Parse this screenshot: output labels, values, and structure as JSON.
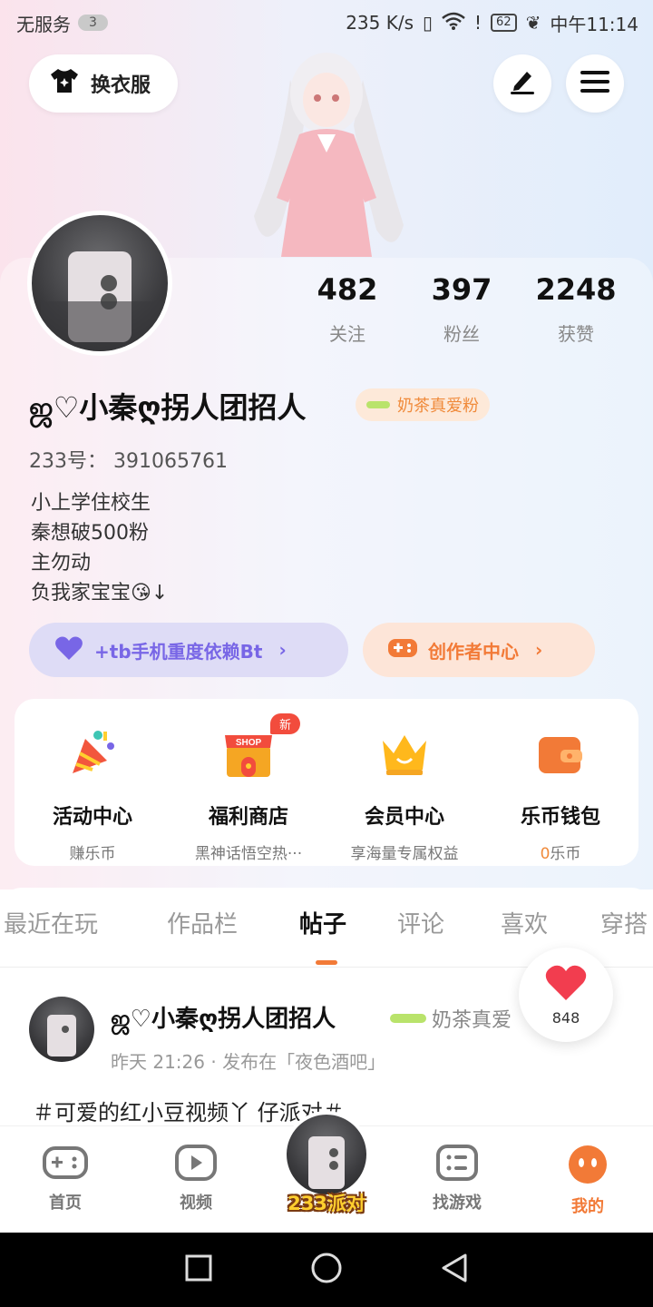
{
  "status_bar": {
    "carrier": "无服务",
    "notif_count": "3",
    "speed": "235 K/s",
    "battery": "62",
    "time": "中午11:14"
  },
  "header": {
    "wardrobe_label": "换衣服"
  },
  "profile": {
    "stats": [
      {
        "value": "482",
        "label": "关注"
      },
      {
        "value": "397",
        "label": "粉丝"
      },
      {
        "value": "2248",
        "label": "获赞"
      }
    ],
    "username": "ஜ♡小秦ღ拐人团招人",
    "fan_badge": "奶茶真爱粉",
    "id_line": "233号：  391065761",
    "bio_lines": [
      "小上学住校生",
      "秦想破500粉",
      "主勿动",
      "负我家宝宝😘↓"
    ]
  },
  "actions": {
    "phone_label": "+tb手机重度依赖Bt",
    "creator_label": "创作者中心"
  },
  "features": [
    {
      "title": "活动中心",
      "sub": "赚乐币"
    },
    {
      "title": "福利商店",
      "sub": "黑神话悟空热···",
      "badge": "新",
      "shop_text": "SHOP"
    },
    {
      "title": "会员中心",
      "sub": "享海量专属权益"
    },
    {
      "title": "乐币钱包",
      "sub_prefix": "0",
      "sub": "乐币"
    }
  ],
  "tabs": [
    "最近在玩",
    "作品栏",
    "帖子",
    "评论",
    "喜欢",
    "穿搭"
  ],
  "post": {
    "author": "ஜ♡小秦ღ拐人团招人",
    "badge": "奶茶真爱",
    "meta": "昨天 21:26 · 发布在「夜色酒吧」",
    "text": "＃可爱的红小豆视频丫 仔派对＃"
  },
  "like": {
    "count": "848"
  },
  "bottom_nav": {
    "items": [
      "首页",
      "视频",
      "找游戏",
      "我的"
    ],
    "center_label": "233派对"
  },
  "colors": {
    "accent": "#f27a37",
    "purple": "#7866e6",
    "heart": "#f23d4f"
  }
}
